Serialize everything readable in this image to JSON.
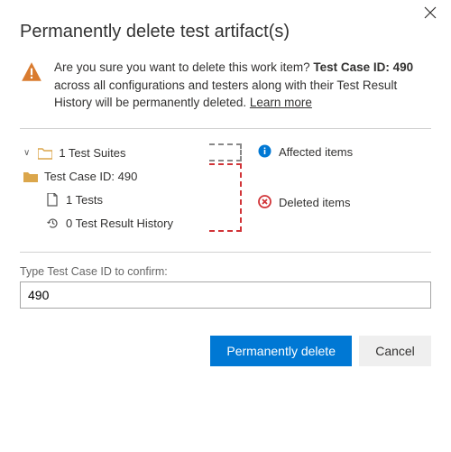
{
  "header": {
    "title": "Permanently delete test artifact(s)"
  },
  "warning": {
    "prefix": "Are you sure you want to delete this work item? ",
    "bold": "Test Case ID: 490",
    "suffix": " across all configurations and testers along with their Test Result History will be permanently deleted. ",
    "learn_more": "Learn more"
  },
  "tree": {
    "suites": "1 Test Suites",
    "case": "Test Case ID: 490",
    "tests": "1 Tests",
    "history": "0 Test Result History"
  },
  "legend": {
    "affected": "Affected items",
    "deleted": "Deleted items"
  },
  "confirm": {
    "label": "Type Test Case ID to confirm:",
    "value": "490"
  },
  "actions": {
    "primary": "Permanently delete",
    "secondary": "Cancel"
  }
}
